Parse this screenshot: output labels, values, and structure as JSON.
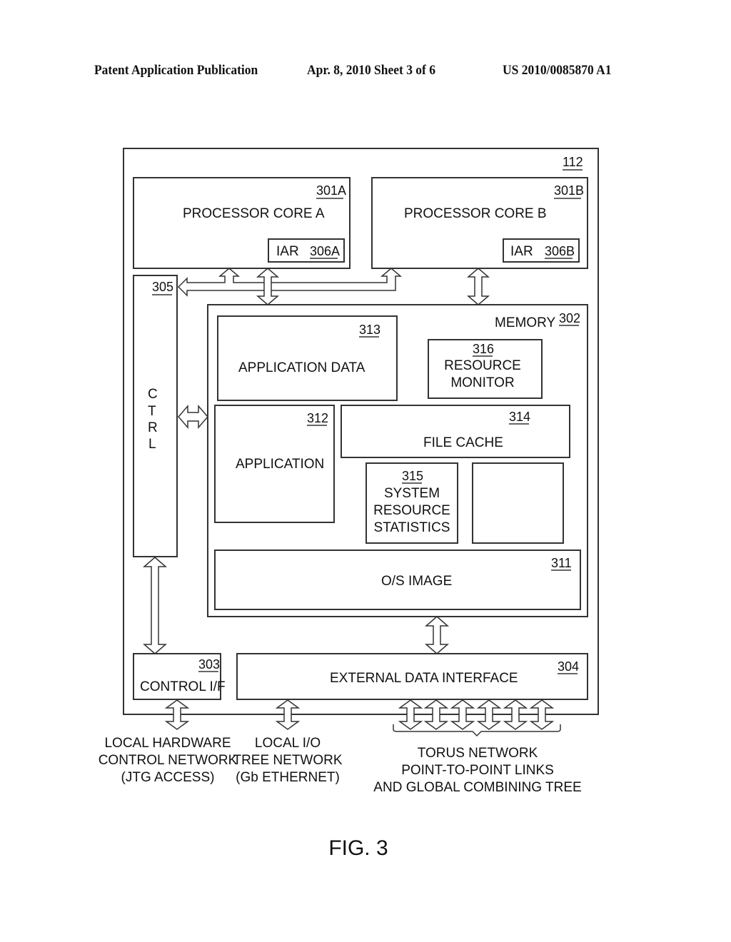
{
  "header": {
    "publication": "Patent Application Publication",
    "date_sheet": "Apr. 8, 2010   Sheet 3 of 6",
    "patent_number": "US 2010/0085870 A1"
  },
  "diagram": {
    "outer": {
      "ref": "112"
    },
    "core_a": {
      "label": "PROCESSOR CORE A",
      "ref": "301A",
      "iar_label": "IAR",
      "iar_ref": "306A"
    },
    "core_b": {
      "label": "PROCESSOR CORE B",
      "ref": "301B",
      "iar_label": "IAR",
      "iar_ref": "306B"
    },
    "ctrl": {
      "ref": "305",
      "letters": [
        "C",
        "T",
        "R",
        "L"
      ]
    },
    "memory": {
      "label": "MEMORY",
      "ref": "302"
    },
    "app_data": {
      "label": "APPLICATION DATA",
      "ref": "313"
    },
    "resource_monitor": {
      "ref": "316",
      "lines": [
        "RESOURCE",
        "MONITOR"
      ]
    },
    "application": {
      "label": "APPLICATION",
      "ref": "312"
    },
    "file_cache": {
      "label": "FILE CACHE",
      "ref": "314"
    },
    "system_stats": {
      "ref": "315",
      "lines": [
        "SYSTEM",
        "RESOURCE",
        "STATISTICS"
      ]
    },
    "os_image": {
      "label": "O/S IMAGE",
      "ref": "311"
    },
    "control_if": {
      "label": "CONTROL I/F",
      "ref": "303"
    },
    "external_if": {
      "label": "EXTERNAL DATA INTERFACE",
      "ref": "304"
    },
    "external_labels": {
      "local_hw": [
        "LOCAL HARDWARE",
        "CONTROL NETWORK",
        "(JTG ACCESS)"
      ],
      "local_io": [
        "LOCAL I/O",
        "TREE NETWORK",
        "(Gb ETHERNET)"
      ],
      "torus": [
        "TORUS NETWORK",
        "POINT-TO-POINT LINKS",
        "AND GLOBAL COMBINING TREE"
      ]
    },
    "figure_label": "FIG. 3"
  }
}
